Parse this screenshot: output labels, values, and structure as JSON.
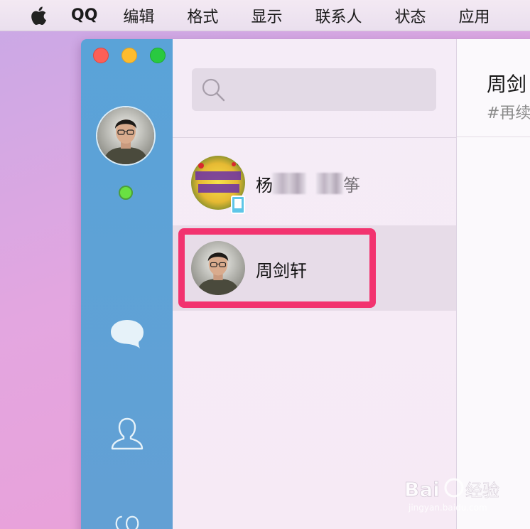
{
  "menubar": {
    "app_name": "QQ",
    "items": [
      {
        "label": "编辑"
      },
      {
        "label": "格式"
      },
      {
        "label": "显示"
      },
      {
        "label": "联系人"
      },
      {
        "label": "状态"
      },
      {
        "label": "应用"
      }
    ]
  },
  "sidebar": {
    "status": "online",
    "status_color": "#69e142",
    "nav": [
      "chat-bubble-icon",
      "contacts-icon",
      "groups-icon"
    ]
  },
  "search": {
    "placeholder": ""
  },
  "contacts": [
    {
      "name": "杨",
      "name_suffix": "筝",
      "device": "phone",
      "selected": false
    },
    {
      "name": "周剑轩",
      "selected": true
    }
  ],
  "chat": {
    "title": "周剑",
    "subtitle": "#再续"
  },
  "colors": {
    "sidebar_blue": "#5aa3d8",
    "highlight": "#f2336f",
    "online": "#69e142"
  },
  "watermark": {
    "text": "Bai经验",
    "sub": "jingyan.baidu.com"
  }
}
